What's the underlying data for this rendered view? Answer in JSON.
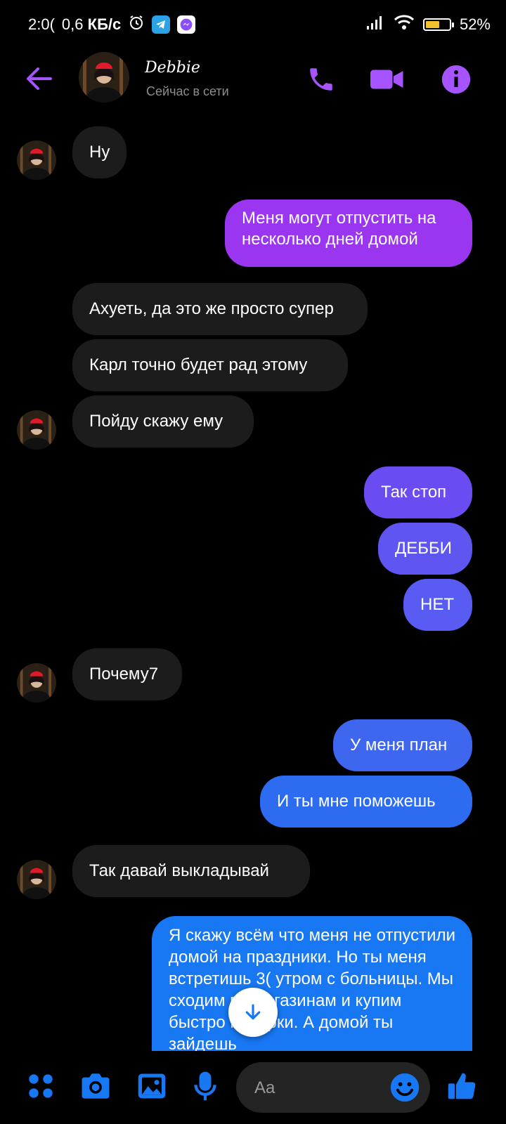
{
  "status_bar": {
    "time": "2:0(",
    "speed": "0,6",
    "speed_unit": "КБ/с",
    "battery": "52%"
  },
  "contact": {
    "name": "Debbie",
    "status": "Сейчас в сети"
  },
  "colors": {
    "accent": "#a654ff",
    "messenger_blue": "#1877f2"
  },
  "messages": [
    {
      "side": "in",
      "text": "Ну"
    },
    {
      "side": "out",
      "text": "Меня могут отпустить на несколько дней домой"
    },
    {
      "side": "in",
      "text": "Ахуеть, да это же просто супер"
    },
    {
      "side": "in",
      "text": "Карл точно будет рад этому"
    },
    {
      "side": "in",
      "text": "Пойду скажу ему"
    },
    {
      "side": "out",
      "text": "Так стоп"
    },
    {
      "side": "out",
      "text": "ДЕББИ"
    },
    {
      "side": "out",
      "text": "НЕТ"
    },
    {
      "side": "in",
      "text": "Почему7"
    },
    {
      "side": "out",
      "text": "У меня план"
    },
    {
      "side": "out",
      "text": "И ты мне поможешь"
    },
    {
      "side": "in",
      "text": "Так давай выкладывай"
    },
    {
      "side": "out",
      "text": "Я скажу всём что меня не отпустили домой на праздники. Но ты меня встретишь 3( утром с больницы. Мы сходим по магазинам и купим быстро подарки. А домой ты зайдешь"
    }
  ],
  "composer": {
    "placeholder": "Aa"
  }
}
